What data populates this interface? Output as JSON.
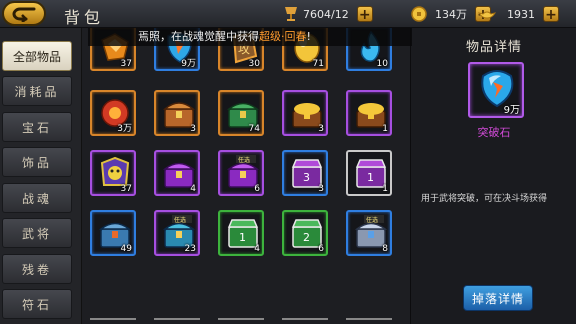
{
  "header": {
    "title": "背包",
    "back_icon": "back-arrow-icon"
  },
  "resources": [
    {
      "name": "stamina",
      "icon": "cup-icon",
      "value": "7604/12"
    },
    {
      "name": "silver",
      "icon": "coin-icon",
      "value": "134万"
    },
    {
      "name": "gold",
      "icon": "ingot-icon",
      "value": "1931"
    }
  ],
  "marquee": {
    "text_before": "焉照，在战魂觉醒中获得",
    "highlight": "超级·回春",
    "text_after": "!"
  },
  "sidebar": {
    "tabs": [
      "全部物品",
      "消耗品",
      "宝石",
      "饰品",
      "战魂",
      "武将",
      "残卷",
      "符石"
    ],
    "active": "全部物品"
  },
  "inventory": {
    "rows": [
      [
        {
          "icon": "orange-gem-icon",
          "rarity": "orange",
          "count": "37"
        },
        {
          "icon": "blue-gem-icon",
          "rarity": "blue",
          "count": "9万"
        },
        {
          "icon": "rune-stone-icon",
          "rarity": "orange",
          "count": "30"
        },
        {
          "icon": "gold-egg-icon",
          "rarity": "orange",
          "count": "71"
        },
        {
          "icon": "blue-flame-icon",
          "rarity": "blue",
          "count": "10"
        }
      ],
      [
        {
          "icon": "red-flower-icon",
          "rarity": "orange",
          "count": "3万"
        },
        {
          "icon": "wooden-chest-icon",
          "rarity": "orange",
          "count": "3"
        },
        {
          "icon": "green-chest-icon",
          "rarity": "orange",
          "count": "74"
        },
        {
          "icon": "gold-chest-icon",
          "rarity": "purple",
          "count": "3"
        },
        {
          "icon": "gold-chest-icon",
          "rarity": "purple",
          "count": "1"
        }
      ],
      [
        {
          "icon": "pet-card-icon",
          "rarity": "purple",
          "count": "37"
        },
        {
          "icon": "purple-chest-icon",
          "rarity": "purple",
          "count": "4"
        },
        {
          "icon": "purple-choice-chest-icon",
          "rarity": "purple",
          "count": "6",
          "tag": "任选"
        },
        {
          "icon": "purple-chest-3-icon",
          "rarity": "blue",
          "count": "3"
        },
        {
          "icon": "purple-chest-1-icon",
          "rarity": "white",
          "count": "1"
        }
      ],
      [
        {
          "icon": "blue-chest-icon",
          "rarity": "blue",
          "count": "49"
        },
        {
          "icon": "blue-choice-chest-icon",
          "rarity": "purple",
          "count": "23",
          "tag": "任选"
        },
        {
          "icon": "green-chest-1-icon",
          "rarity": "green",
          "count": "4"
        },
        {
          "icon": "green-chest-2-icon",
          "rarity": "green",
          "count": "6"
        },
        {
          "icon": "silver-choice-chest-icon",
          "rarity": "blue",
          "count": "8",
          "tag": "任选"
        }
      ]
    ]
  },
  "detail": {
    "title": "物品详情",
    "item_icon": "breakthrough-stone-icon",
    "item_count": "9万",
    "item_name": "突破石",
    "description": "用于武将突破，可在决斗场获得",
    "drop_button": "掉落详情"
  },
  "colors": {
    "orange": "#d8852a",
    "purple": "#a64fe0",
    "blue": "#2f7ee0",
    "green": "#3db33d",
    "white": "#c9c9c9",
    "highlight": "#ff9c2f",
    "item_name": "#d24bd8"
  }
}
